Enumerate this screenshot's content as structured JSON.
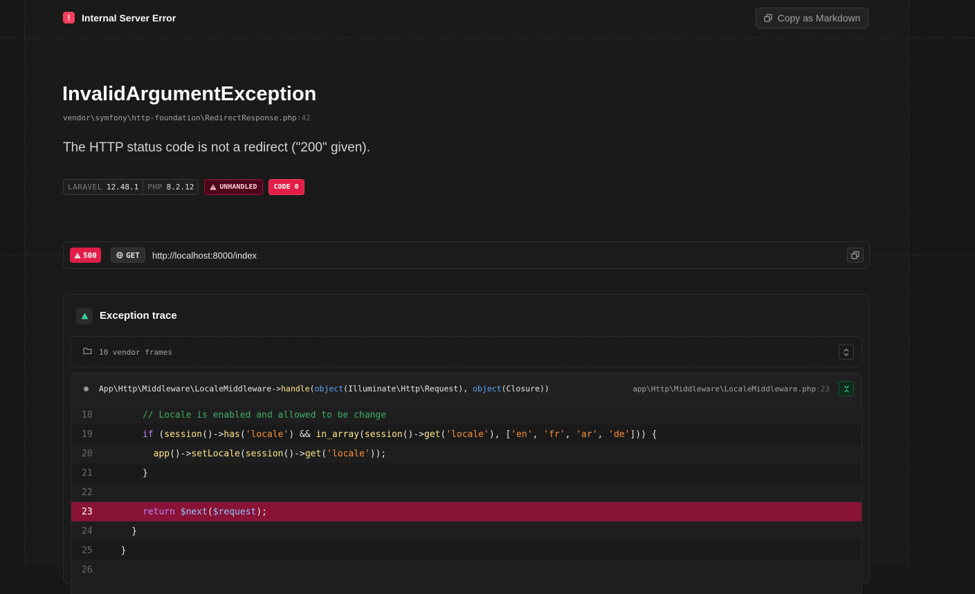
{
  "header": {
    "title": "Internal Server Error",
    "error_icon_glyph": "!",
    "copy_label": "Copy as Markdown"
  },
  "exception": {
    "class": "InvalidArgumentException",
    "file": "vendor\\symfony\\http-foundation\\RedirectResponse.php",
    "line": ":42",
    "message": "The HTTP status code is not a redirect (\"200\" given)."
  },
  "badges": {
    "framework_name": "LARAVEL",
    "framework_version": "12.48.1",
    "php_name": "PHP",
    "php_version": "8.2.12",
    "unhandled": "UNHANDLED",
    "code": "CODE 0"
  },
  "request": {
    "status": "500",
    "method": "GET",
    "url": "http://localhost:8000/index"
  },
  "trace": {
    "title": "Exception trace",
    "vendor_frames": "10 vendor frames",
    "frame": {
      "class_method": "App\\Http\\Middleware\\LocaleMiddleware->",
      "method": "handle",
      "args_open": "(",
      "arg1_kw": "object",
      "arg1": "(Illuminate\\Http\\Request), ",
      "arg2_kw": "object",
      "arg2": "(Closure))",
      "file": "app\\Http\\Middleware\\LocaleMiddleware.php",
      "line": ":23"
    },
    "code_lines": [
      {
        "num": "18",
        "text": "      // Locale is enabled and allowed to be change"
      },
      {
        "num": "19",
        "text": "      if (session()->has('locale') && in_array(session()->get('locale'), ['en', 'fr', 'ar', 'de'])) {"
      },
      {
        "num": "20",
        "text": "        app()->setLocale(session()->get('locale'));"
      },
      {
        "num": "21",
        "text": "      }"
      },
      {
        "num": "22",
        "text": ""
      },
      {
        "num": "23",
        "text": "      return $next($request);"
      },
      {
        "num": "24",
        "text": "    }"
      },
      {
        "num": "25",
        "text": "  }"
      },
      {
        "num": "26",
        "text": ""
      }
    ]
  },
  "colors": {
    "background": "#171717",
    "accent_red": "#e11d48",
    "highlight_line": "#881337",
    "trace_icon": "#34d399"
  },
  "icons": {
    "error": "exclamation-icon",
    "copy": "copy-icon",
    "warning": "warning-triangle-icon",
    "globe": "globe-icon",
    "trace": "trace-triangle-icon",
    "folder": "folder-icon",
    "expand": "chevron-up-down-icon",
    "collapse": "chevrons-collapse-icon"
  }
}
